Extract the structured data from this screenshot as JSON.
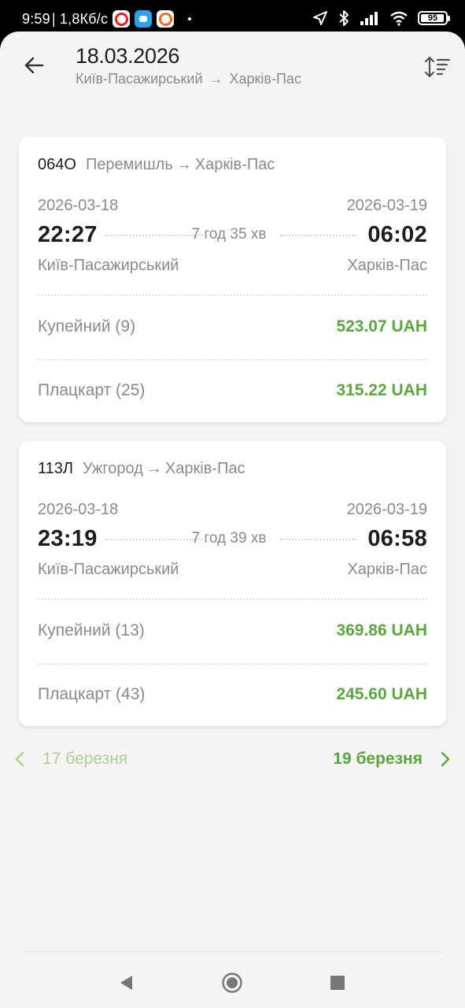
{
  "status_bar": {
    "time": "9:59",
    "speed": "| 1,8Кб/с",
    "battery": "95",
    "battery_level": 0.95
  },
  "header": {
    "title": "18.03.2026",
    "from": "Київ-Пасажирський",
    "arrow": "→",
    "to": "Харків-Пас"
  },
  "trains": [
    {
      "number": "064О",
      "route_from": "Перемишль",
      "route_arrow": "→",
      "route_to": "Харків-Пас",
      "dep_date": "2026-03-18",
      "arr_date": "2026-03-19",
      "dep_time": "22:27",
      "arr_time": "06:02",
      "duration": "7 год 35 хв",
      "dep_station": "Київ-Пасажирський",
      "arr_station": "Харків-Пас",
      "classes": [
        {
          "name": "Купейний (9)",
          "price": "523.07 UAH"
        },
        {
          "name": "Плацкарт (25)",
          "price": "315.22 UAH"
        }
      ]
    },
    {
      "number": "113Л",
      "route_from": "Ужгород",
      "route_arrow": "→",
      "route_to": "Харків-Пас",
      "dep_date": "2026-03-18",
      "arr_date": "2026-03-19",
      "dep_time": "23:19",
      "arr_time": "06:58",
      "duration": "7 год 39 хв",
      "dep_station": "Київ-Пасажирський",
      "arr_station": "Харків-Пас",
      "classes": [
        {
          "name": "Купейний (13)",
          "price": "369.86 UAH"
        },
        {
          "name": "Плацкарт (43)",
          "price": "245.60 UAH"
        }
      ]
    }
  ],
  "pager": {
    "prev_label": "17 березня",
    "next_label": "19 березня"
  },
  "icons": {
    "back": "arrow-left-icon",
    "sort": "sort-icon",
    "prev": "chevron-left-icon",
    "next": "chevron-right-icon"
  },
  "colors": {
    "price_green": "#5aa83c",
    "prev_green": "#a9d191",
    "background": "#f4f4f4",
    "card": "#ffffff"
  }
}
